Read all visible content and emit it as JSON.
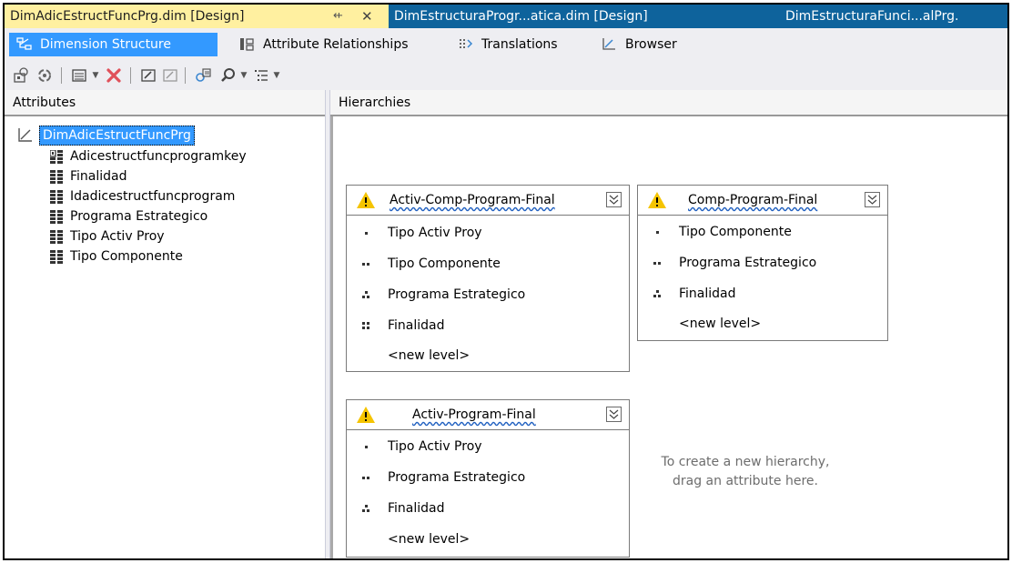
{
  "doc_tabs": [
    {
      "label": "DimAdicEstructFuncPrg.dim [Design]",
      "active": true
    },
    {
      "label": "DimEstructuraProgr...atica.dim [Design]",
      "active": false
    },
    {
      "label": "DimEstructuraFunci...alPrg.",
      "active": false
    }
  ],
  "doc_tab_pin_icon": "⇷",
  "doc_tab_close_icon": "✕",
  "designer_tabs": [
    {
      "label": "Dimension Structure",
      "icon": "dimension-structure-icon",
      "active": true
    },
    {
      "label": "Attribute Relationships",
      "icon": "attribute-relationships-icon",
      "active": false
    },
    {
      "label": "Translations",
      "icon": "translations-icon",
      "active": false
    },
    {
      "label": "Browser",
      "icon": "browser-icon",
      "active": false
    }
  ],
  "toolbar": {
    "icons": [
      "process-icon",
      "reconnect-icon",
      "view-icon",
      "delete-icon",
      "rename-icon",
      "properties-icon",
      "new-hierarchy-icon",
      "zoom-icon",
      "layout-icon"
    ]
  },
  "attributes_pane": {
    "title": "Attributes",
    "dimension": "DimAdicEstructFuncPrg",
    "items": [
      {
        "label": "Adicestructfuncprogramkey",
        "icon": "key-attribute-icon"
      },
      {
        "label": "Finalidad",
        "icon": "attribute-icon"
      },
      {
        "label": "Idadicestructfuncprogram",
        "icon": "attribute-icon"
      },
      {
        "label": "Programa Estrategico",
        "icon": "attribute-icon"
      },
      {
        "label": "Tipo Activ Proy",
        "icon": "attribute-icon"
      },
      {
        "label": "Tipo Componente",
        "icon": "attribute-icon"
      }
    ]
  },
  "hierarchies_pane": {
    "title": "Hierarchies",
    "hierarchies": [
      {
        "name": "Activ-Comp-Program-Final",
        "levels": [
          "Tipo Activ Proy",
          "Tipo Componente",
          "Programa Estrategico",
          "Finalidad"
        ],
        "new_level": "<new level>"
      },
      {
        "name": "Comp-Program-Final",
        "levels": [
          "Tipo Componente",
          "Programa Estrategico",
          "Finalidad"
        ],
        "new_level": "<new level>"
      },
      {
        "name": "Activ-Program-Final",
        "levels": [
          "Tipo Activ Proy",
          "Programa Estrategico",
          "Finalidad"
        ],
        "new_level": "<new level>"
      }
    ],
    "hint_line1": "To create a new hierarchy,",
    "hint_line2": "drag an attribute here."
  },
  "colors": {
    "active_doc_tab": "#fff0a0",
    "inactive_doc_tab": "#0e639c",
    "selection": "#3399ff",
    "warning": "#f5c400"
  }
}
